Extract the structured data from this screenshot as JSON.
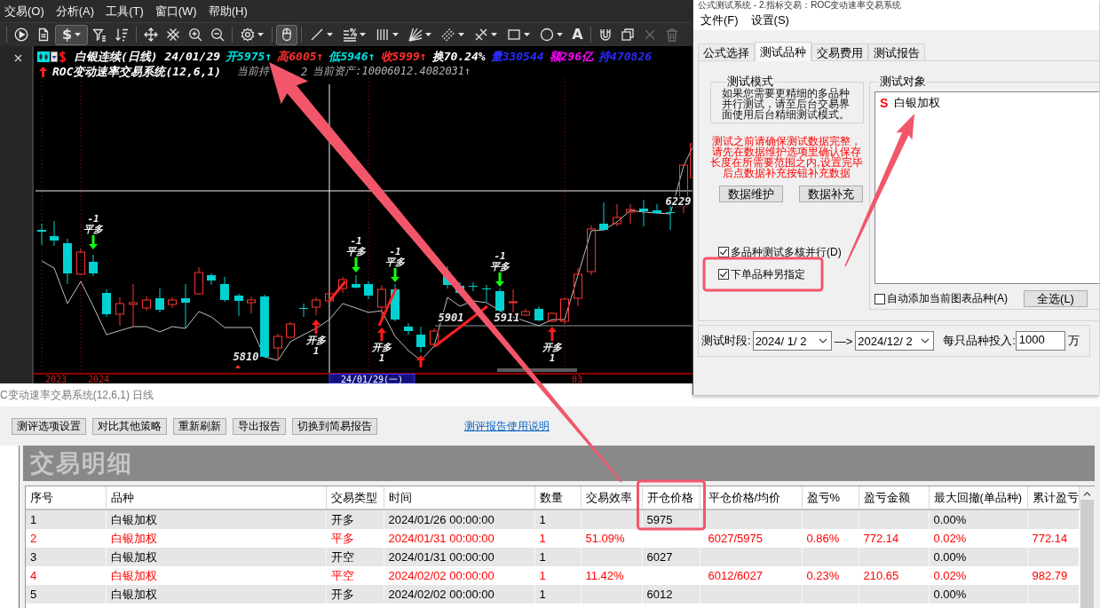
{
  "main_menu": [
    "交易(O)",
    "分析(A)",
    "工具(T)",
    "窗口(W)",
    "帮助(H)"
  ],
  "toolbar": {
    "groups": [
      [
        {
          "selected": false,
          "disabled": false,
          "dropdown": false
        },
        {
          "selected": false,
          "disabled": false,
          "dropdown": false
        },
        {
          "glyph": "$",
          "selected": true,
          "disabled": false,
          "dropdown": true
        },
        {
          "selected": false,
          "disabled": false,
          "dropdown": false
        },
        {
          "selected": false,
          "disabled": false,
          "dropdown": false
        }
      ],
      [
        {
          "selected": false,
          "disabled": false,
          "dropdown": false
        },
        {
          "selected": false,
          "disabled": false,
          "dropdown": false
        },
        {
          "selected": false,
          "disabled": false,
          "dropdown": false
        },
        {
          "selected": false,
          "disabled": false,
          "dropdown": false
        }
      ],
      [
        {
          "selected": false,
          "disabled": false,
          "dropdown": true
        }
      ],
      [
        {
          "selected": true,
          "disabled": false,
          "dropdown": false
        }
      ],
      [
        {
          "selected": false,
          "disabled": false,
          "dropdown": true
        },
        {
          "selected": false,
          "disabled": false,
          "dropdown": true
        },
        {
          "selected": false,
          "disabled": false,
          "dropdown": true
        },
        {
          "selected": false,
          "disabled": false,
          "dropdown": true
        },
        {
          "selected": false,
          "disabled": false,
          "dropdown": true
        },
        {
          "selected": false,
          "disabled": false,
          "dropdown": true
        },
        {
          "selected": false,
          "disabled": false,
          "dropdown": true
        },
        {
          "selected": false,
          "disabled": false,
          "dropdown": true
        },
        {
          "glyph": "A",
          "selected": false,
          "disabled": false,
          "dropdown": false
        }
      ],
      [
        {
          "selected": false,
          "disabled": false,
          "dropdown": false
        },
        {
          "selected": false,
          "disabled": false,
          "dropdown": false
        },
        {
          "selected": false,
          "disabled": true,
          "dropdown": false
        },
        {
          "selected": false,
          "disabled": true,
          "dropdown": false
        }
      ]
    ]
  },
  "chart": {
    "symbol_title": "白银连续(日线) 24/01/29",
    "quotes": [
      {
        "text": "开5975↑",
        "color": "#00e0e0"
      },
      {
        "text": "高6005↑",
        "color": "#ff3030"
      },
      {
        "text": "低5946↑",
        "color": "#00e0e0"
      },
      {
        "text": "收5999↑",
        "color": "#ff3030"
      },
      {
        "text": "换70.24%",
        "color": "#ffffff"
      },
      {
        "text": "量330544",
        "color": "#2a2aff"
      },
      {
        "text": "额296亿",
        "color": "#ff00ff"
      },
      {
        "text": "持470826",
        "color": "#2a2aff"
      }
    ],
    "system_name": "ROC变动速率交易系统(12,6,1)",
    "status": [
      "当前持",
      "2",
      "当前资产:10006012.4082031↑"
    ],
    "signals": [
      {
        "kind": "close_long",
        "qty": "-1",
        "label": "平多"
      },
      {
        "kind": "open_long",
        "label": "开多",
        "qty": "1"
      },
      {
        "kind": "close_long",
        "qty": "-1",
        "label": "平多"
      },
      {
        "kind": "open_long",
        "label": "开多",
        "qty": "1"
      },
      {
        "kind": "close_long",
        "qty": "-1",
        "label": "平多"
      },
      {
        "kind": "open_long"
      },
      {
        "kind": "close_long",
        "qty": "-1",
        "label": "平多"
      },
      {
        "kind": "open_long",
        "label": "开多",
        "qty": "1"
      }
    ],
    "price_labels": [
      "5810",
      "5901",
      "5911",
      "6229"
    ],
    "axis_labels": [
      "2023",
      "2024",
      "03"
    ],
    "cursor_date": "24/01/29(一)"
  },
  "dialog": {
    "title": "公式测试系统 - 2.指标交易：ROC变动速率交易系统",
    "menu": [
      "文件(F)",
      "设置(S)"
    ],
    "tabs": [
      {
        "label": "公式选择",
        "selected": false
      },
      {
        "label": "测试品种",
        "selected": true
      },
      {
        "label": "交易费用",
        "selected": false
      },
      {
        "label": "测试报告",
        "selected": false
      }
    ],
    "test_mode": {
      "title": "测试模式",
      "text": "如果您需要更精细的多品种并行测试，请至后台交易界面使用后台精细测试模式。"
    },
    "warning": "测试之前请确保测试数据完整，请先在数据维护选项里确认保存长度在所需要范围之内,设置完毕后点数据补充按钮补充数据",
    "data_buttons": [
      "数据维护",
      "数据补充"
    ],
    "options": [
      {
        "label": "多品种测试多核并行(D)",
        "checked": true
      },
      {
        "label": "下单品种另指定",
        "checked": true
      }
    ],
    "targets": {
      "title": "测试对象",
      "items": [
        {
          "marker": "S",
          "label": "白银加权"
        }
      ]
    },
    "auto_add": {
      "label": "自动添加当前图表品种(A)",
      "checked": false
    },
    "select_all": "全选(L)",
    "period": {
      "label": "测试时段:",
      "start": "2024/ 1/ 2",
      "arrow": "—>",
      "end": "2024/12/ 2"
    },
    "investment": {
      "label": "每只品种投入:",
      "value": "1000",
      "unit": "万"
    }
  },
  "report": {
    "caption": "C变动速率交易系统(12,6,1) 日线",
    "buttons": [
      "测评选项设置",
      "对比其他策略",
      "重新刷新",
      "导出报告",
      "切换到简易报告"
    ],
    "help_link": "测评报告使用说明",
    "section_title": "交易明细",
    "table": {
      "columns": [
        "序号",
        "品种",
        "交易类型",
        "时间",
        "数量",
        "交易效率",
        "开仓价格",
        "平仓价格/均价",
        "盈亏%",
        "盈亏金额",
        "最大回撤(单品种)",
        "累计盈亏"
      ],
      "rows": [
        {
          "color": "#000000",
          "cells": [
            "1",
            "白银加权",
            "开多",
            "2024/01/26 00:00:00",
            "1",
            null,
            "5975",
            null,
            null,
            null,
            "0.00%",
            null
          ]
        },
        {
          "color": "#ff0000",
          "cells": [
            "2",
            "白银加权",
            "平多",
            "2024/01/31 00:00:00",
            "1",
            "51.09%",
            null,
            "6027/5975",
            "0.86%",
            "772.14",
            "0.02%",
            "772.14"
          ]
        },
        {
          "color": "#000000",
          "cells": [
            "3",
            "白银加权",
            "开空",
            "2024/01/31 00:00:00",
            "1",
            null,
            "6027",
            null,
            null,
            null,
            "0.00%",
            null
          ]
        },
        {
          "color": "#ff0000",
          "cells": [
            "4",
            "白银加权",
            "平空",
            "2024/02/02 00:00:00",
            "1",
            "11.42%",
            null,
            "6012/6027",
            "0.23%",
            "210.65",
            "0.02%",
            "982.79"
          ]
        },
        {
          "color": "#000000",
          "cells": [
            "5",
            "白银加权",
            "开多",
            "2024/02/02 00:00:00",
            "1",
            null,
            "6012",
            null,
            null,
            null,
            "0.00%",
            null
          ]
        }
      ]
    }
  },
  "annotations": [
    {
      "kind": "arrow"
    },
    {
      "kind": "arrow"
    },
    {
      "kind": "box"
    },
    {
      "kind": "box"
    }
  ]
}
